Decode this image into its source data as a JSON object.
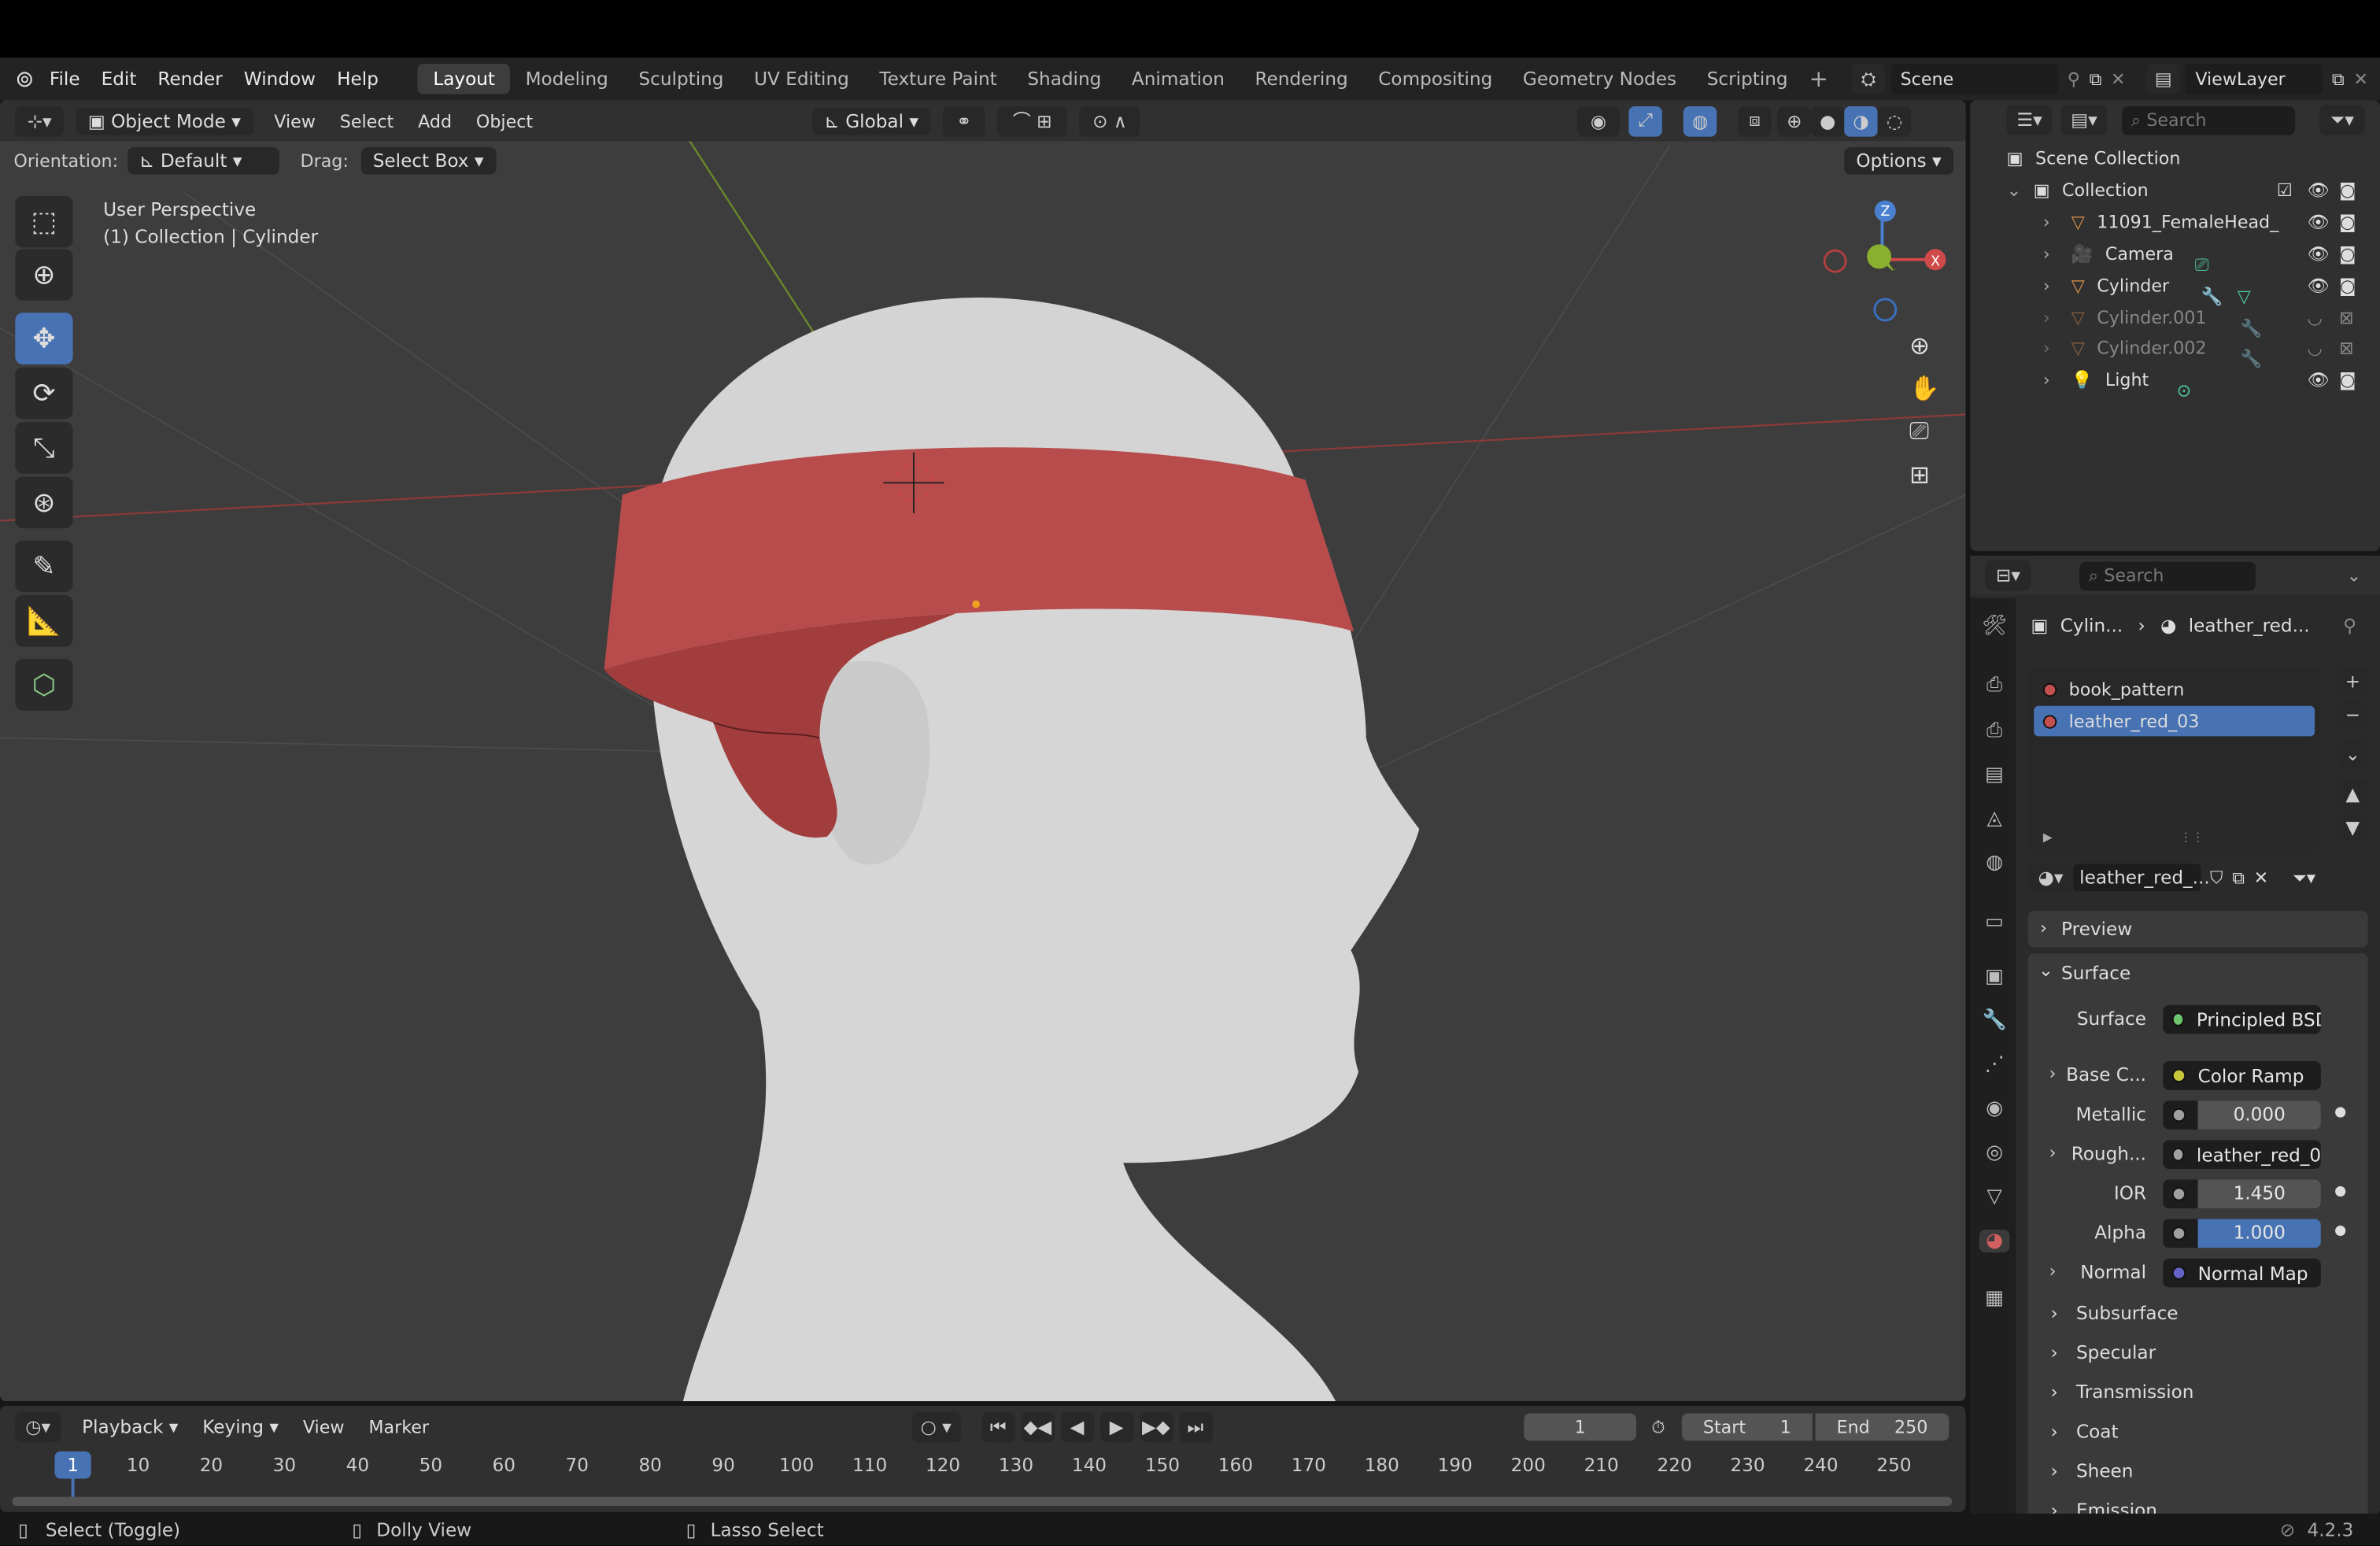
{
  "app": {
    "menu": [
      "File",
      "Edit",
      "Render",
      "Window",
      "Help"
    ],
    "workspaces": [
      "Layout",
      "Modeling",
      "Sculpting",
      "UV Editing",
      "Texture Paint",
      "Shading",
      "Animation",
      "Rendering",
      "Compositing",
      "Geometry Nodes",
      "Scripting"
    ],
    "active_workspace": "Layout",
    "scene": "Scene",
    "view_layer": "ViewLayer"
  },
  "viewport": {
    "mode": "Object Mode",
    "menus": [
      "View",
      "Select",
      "Add",
      "Object"
    ],
    "transform_orientation": "Global",
    "orientation_label": "Orientation:",
    "orientation_value": "Default",
    "drag_label": "Drag:",
    "drag_value": "Select Box",
    "options": "Options",
    "overlay_title": "User Perspective",
    "overlay_subtitle": "(1) Collection | Cylinder",
    "gizmo": {
      "x": "X",
      "y": "Y",
      "z": "Z"
    },
    "tools": [
      "select-box",
      "cursor",
      "move",
      "rotate",
      "scale",
      "transform",
      "annotate",
      "measure",
      "add-cube"
    ],
    "active_tool": "move"
  },
  "outliner": {
    "search_placeholder": "Search",
    "scene_collection": "Scene Collection",
    "collection": "Collection",
    "items": [
      {
        "name": "11091_FemaleHead_",
        "type": "mesh",
        "visible": true
      },
      {
        "name": "Camera",
        "type": "camera",
        "visible": true
      },
      {
        "name": "Cylinder",
        "type": "mesh",
        "visible": true
      },
      {
        "name": "Cylinder.001",
        "type": "mesh",
        "visible": false
      },
      {
        "name": "Cylinder.002",
        "type": "mesh",
        "visible": false
      },
      {
        "name": "Light",
        "type": "light",
        "visible": true
      }
    ]
  },
  "properties": {
    "search_placeholder": "Search",
    "breadcrumb": [
      "Cylin...",
      "leather_red..."
    ],
    "slots": [
      "book_pattern",
      "leather_red_03"
    ],
    "active_slot": "leather_red_03",
    "material_name": "leather_red_...",
    "panels": {
      "preview": "Preview",
      "surface": "Surface"
    },
    "surface_rows": [
      {
        "label": "Surface",
        "value": "Principled BSDF",
        "socket": "#6fc46f",
        "expand": false
      },
      {
        "label": "Base C...",
        "value": "Color Ramp",
        "socket": "#c8c83c",
        "expand": true
      },
      {
        "label": "Metallic",
        "value": "0.000",
        "socket": "#a0a0a0",
        "numeric": true
      },
      {
        "label": "Rough...",
        "value": "leather_red_0...",
        "socket": "#a0a0a0",
        "expand": true
      },
      {
        "label": "IOR",
        "value": "1.450",
        "socket": "#a0a0a0",
        "numeric": true
      },
      {
        "label": "Alpha",
        "value": "1.000",
        "socket": "#a0a0a0",
        "numeric": true,
        "highlight": true
      },
      {
        "label": "Normal",
        "value": "Normal Map",
        "socket": "#6363c7",
        "expand": true
      }
    ],
    "subpanels": [
      "Subsurface",
      "Specular",
      "Transmission",
      "Coat",
      "Sheen",
      "Emission"
    ]
  },
  "timeline": {
    "menus": [
      "Playback",
      "Keying",
      "View",
      "Marker"
    ],
    "current_frame": "1",
    "start_label": "Start",
    "start": "1",
    "end_label": "End",
    "end": "250",
    "ticks": [
      "10",
      "20",
      "30",
      "40",
      "50",
      "60",
      "70",
      "80",
      "90",
      "100",
      "110",
      "120",
      "130",
      "140",
      "150",
      "160",
      "170",
      "180",
      "190",
      "200",
      "210",
      "220",
      "230",
      "240",
      "250"
    ]
  },
  "statusbar": {
    "items": [
      "Select (Toggle)",
      "Dolly View",
      "Lasso Select"
    ],
    "version": "4.2.3"
  },
  "colors": {
    "accent": "#4772b3",
    "headband": "#b84c4c",
    "head": "#d8d8d8",
    "object_orange": "#e0904a"
  }
}
